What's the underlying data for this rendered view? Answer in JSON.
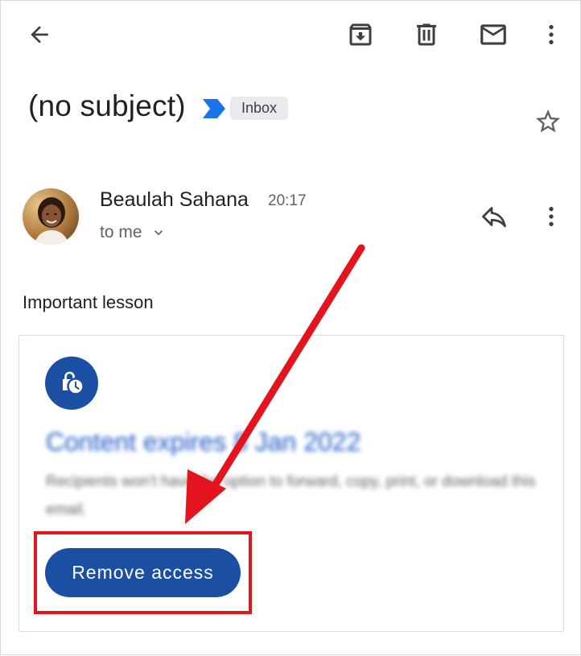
{
  "toolbar": {
    "back_icon": "arrow-left-icon",
    "archive_icon": "archive-icon",
    "delete_icon": "trash-icon",
    "mark_unread_icon": "mail-icon",
    "more_icon": "more-vert-icon"
  },
  "email": {
    "subject": "(no subject)",
    "label": "Inbox",
    "importance_icon": "importance-marker-icon",
    "star_icon": "star-outline-icon",
    "sender": "Beaulah Sahana",
    "time": "20:17",
    "recipient": "to me",
    "body": "Important lesson"
  },
  "confidential_card": {
    "icon": "expiring-lock-clock-icon",
    "title": "Content expires 8 Jan 2022",
    "description": "Recipients won't have the option to forward, copy, print, or download this email.",
    "button_label": "Remove access"
  },
  "colors": {
    "accent_blue": "#1a4fa3",
    "link_blue": "#1a56c6",
    "annotation_red": "#e3141e",
    "chip_bg": "#e8eaed"
  }
}
